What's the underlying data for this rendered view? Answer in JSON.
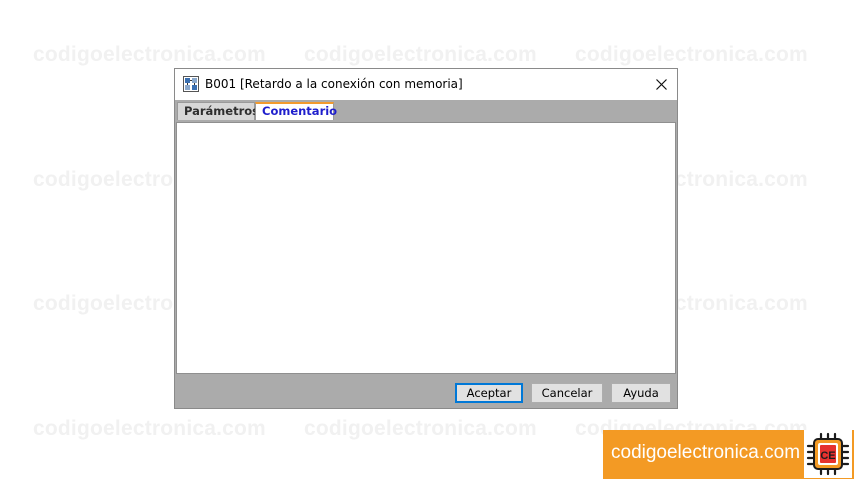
{
  "watermark": {
    "text": "codigoelectronica.com"
  },
  "dialog": {
    "title": "B001 [Retardo a la conexión con memoria]",
    "tabs": [
      {
        "label": "Parámetros",
        "active": false
      },
      {
        "label": "Comentario",
        "active": true
      }
    ],
    "comment_text": "",
    "buttons": {
      "ok": "Aceptar",
      "cancel": "Cancelar",
      "help": "Ayuda"
    }
  },
  "brand": {
    "text": "codigoelectronica.com",
    "logo_letters": "CE",
    "color": "#f39a24"
  },
  "colors": {
    "active_tab_text": "#1e1ecc",
    "active_tab_accent": "#f29a2e",
    "default_button_border": "#0078d7"
  }
}
